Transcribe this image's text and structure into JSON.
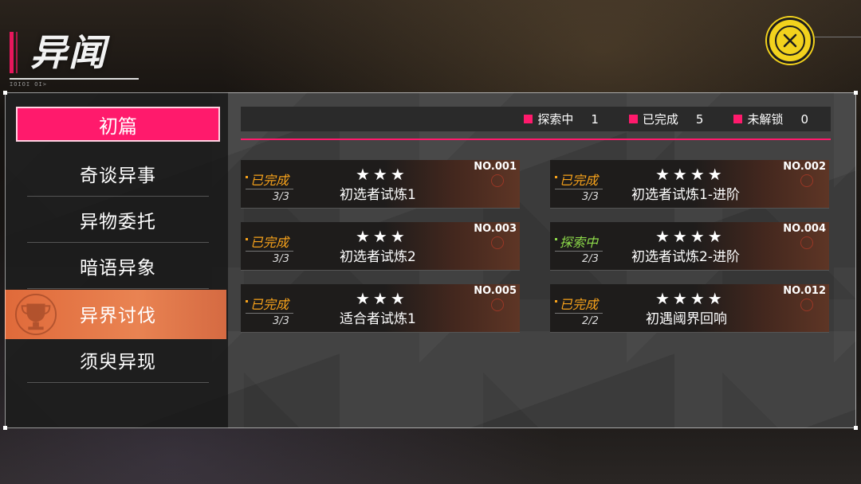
{
  "header": {
    "title": "异闻",
    "subtitle": "IOIOI OI>"
  },
  "sidebar": {
    "chapter": "初篇",
    "items": [
      {
        "label": "奇谈异事",
        "active": false
      },
      {
        "label": "异物委托",
        "active": false
      },
      {
        "label": "暗语异象",
        "active": false
      },
      {
        "label": "异界讨伐",
        "active": true
      },
      {
        "label": "须臾异现",
        "active": false
      }
    ]
  },
  "status_bar": {
    "exploring_label": "探索中",
    "exploring_count": "1",
    "completed_label": "已完成",
    "completed_count": "5",
    "locked_label": "未解锁",
    "locked_count": "0"
  },
  "cards": [
    {
      "no": "NO.001",
      "status": "已完成",
      "progress": "3/3",
      "stars": "★★★",
      "name": "初选者试炼1"
    },
    {
      "no": "NO.002",
      "status": "已完成",
      "progress": "3/3",
      "stars": "★★★★",
      "name": "初选者试炼1-进阶"
    },
    {
      "no": "NO.003",
      "status": "已完成",
      "progress": "3/3",
      "stars": "★★★",
      "name": "初选者试炼2"
    },
    {
      "no": "NO.004",
      "status": "探索中",
      "progress": "2/3",
      "stars": "★★★★",
      "name": "初选者试炼2-进阶"
    },
    {
      "no": "NO.005",
      "status": "已完成",
      "progress": "3/3",
      "stars": "★★★",
      "name": "适合者试炼1"
    },
    {
      "no": "NO.012",
      "status": "已完成",
      "progress": "2/2",
      "stars": "★★★★",
      "name": "初遇阈界回响"
    }
  ],
  "colors": {
    "accent": "#ff1a6c",
    "completed": "#f7a21b",
    "exploring": "#8edb4a",
    "close_button": "#f2d21d"
  },
  "icons": {
    "close": "close-x-icon",
    "active_nav": "trophy-icon"
  }
}
